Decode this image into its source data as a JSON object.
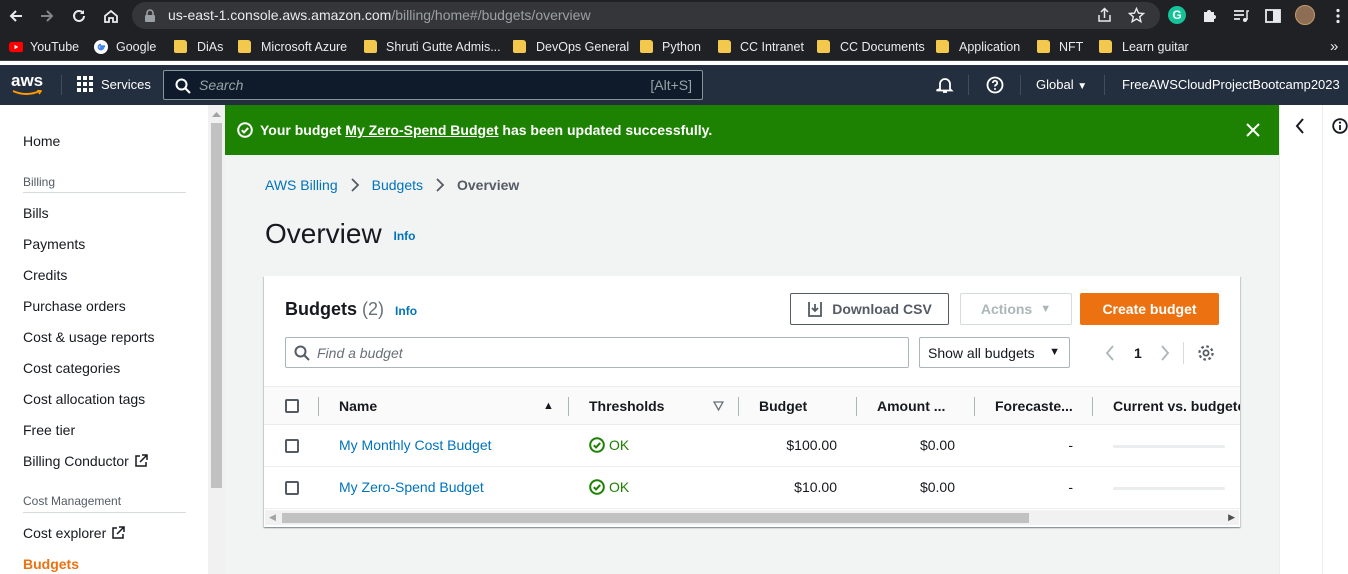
{
  "browser": {
    "url_host": "us-east-1.console.aws.amazon.com",
    "url_path": "/billing/home#/budgets/overview",
    "profile_initial": "G",
    "bookmarks": [
      {
        "label": "YouTube",
        "icon": "youtube-icon"
      },
      {
        "label": "Google",
        "icon": "google-icon"
      },
      {
        "label": "DiAs",
        "icon": "folder-icon"
      },
      {
        "label": "Microsoft Azure",
        "icon": "folder-icon"
      },
      {
        "label": "Shruti Gutte Admis...",
        "icon": "folder-icon"
      },
      {
        "label": "DevOps General",
        "icon": "folder-icon"
      },
      {
        "label": "Python",
        "icon": "folder-icon"
      },
      {
        "label": "CC Intranet",
        "icon": "folder-icon"
      },
      {
        "label": "CC Documents",
        "icon": "folder-icon"
      },
      {
        "label": "Application",
        "icon": "folder-icon"
      },
      {
        "label": "NFT",
        "icon": "folder-icon"
      },
      {
        "label": "Learn guitar",
        "icon": "folder-icon"
      }
    ],
    "overflow": "»"
  },
  "aws_nav": {
    "logo": "aws",
    "services": "Services",
    "search_placeholder": "Search",
    "search_shortcut": "[Alt+S]",
    "region": "Global",
    "account": "FreeAWSCloudProjectBootcamp2023"
  },
  "sidenav": {
    "home": "Home",
    "billing_heading": "Billing",
    "billing_items": [
      "Bills",
      "Payments",
      "Credits",
      "Purchase orders",
      "Cost & usage reports",
      "Cost categories",
      "Cost allocation tags",
      "Free tier",
      "Billing Conductor"
    ],
    "cost_heading": "Cost Management",
    "cost_items": [
      "Cost explorer",
      "Budgets"
    ]
  },
  "flash": {
    "prefix": "Your budget",
    "budget_link": "My Zero-Spend Budget",
    "suffix": "has been updated successfully."
  },
  "breadcrumb": [
    "AWS Billing",
    "Budgets",
    "Overview"
  ],
  "page": {
    "title": "Overview",
    "info": "Info"
  },
  "budgets_panel": {
    "title": "Budgets",
    "count": "(2)",
    "info": "Info",
    "download_csv": "Download CSV",
    "actions": "Actions",
    "create_budget": "Create budget",
    "find_placeholder": "Find a budget",
    "filter_value": "Show all budgets",
    "page_number": "1",
    "columns": [
      "Name",
      "Thresholds",
      "Budget",
      "Amount ...",
      "Forecaste...",
      "Current vs. budgete"
    ],
    "rows": [
      {
        "name": "My Monthly Cost Budget",
        "threshold": "OK",
        "budget": "$100.00",
        "amount": "$0.00",
        "forecast": "-"
      },
      {
        "name": "My Zero-Spend Budget",
        "threshold": "OK",
        "budget": "$10.00",
        "amount": "$0.00",
        "forecast": "-"
      }
    ]
  },
  "colors": {
    "aws_nav_bg": "#232f3e",
    "success_green": "#1d8102",
    "link_blue": "#0073bb",
    "primary_orange": "#ec7211",
    "active_nav_orange": "#ec7211"
  }
}
